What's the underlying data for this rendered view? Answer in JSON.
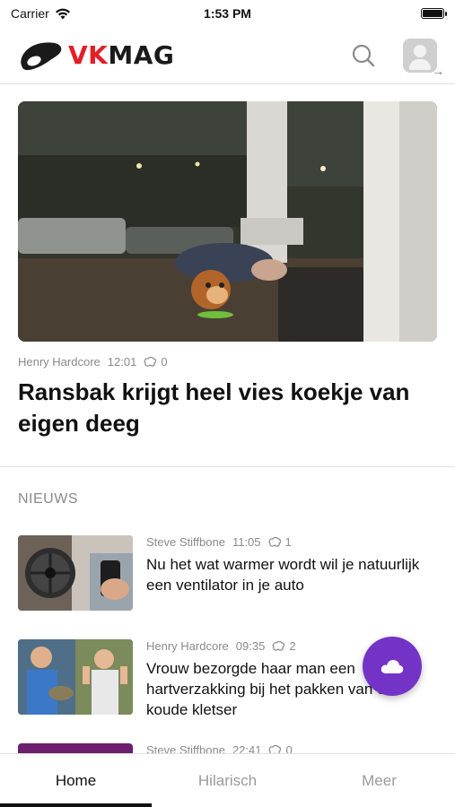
{
  "status_bar": {
    "carrier": "Carrier",
    "time": "1:53 PM"
  },
  "header": {
    "logo_vk": "VK",
    "logo_mag": "MAG"
  },
  "hero": {
    "author": "Henry Hardcore",
    "time": "12:01",
    "views": "0",
    "title": "Ransbak krijgt heel vies koekje van eigen deeg"
  },
  "section": {
    "title": "NIEUWS"
  },
  "news": [
    {
      "author": "Steve Stiffbone",
      "time": "11:05",
      "views": "1",
      "title": "Nu het wat warmer wordt wil je natuurlijk een ventilator in je auto"
    },
    {
      "author": "Henry Hardcore",
      "time": "09:35",
      "views": "2",
      "title": "Vrouw bezorgde haar man een hartverzakking bij het pakken van een koude kletser"
    },
    {
      "author": "Steve Stiffbone",
      "time": "22:41",
      "views": "0",
      "title": ""
    }
  ],
  "tabs": [
    "Home",
    "Hilarisch",
    "Meer"
  ],
  "colors": {
    "brand_red": "#e31f26",
    "fab_purple": "#7433c7"
  }
}
